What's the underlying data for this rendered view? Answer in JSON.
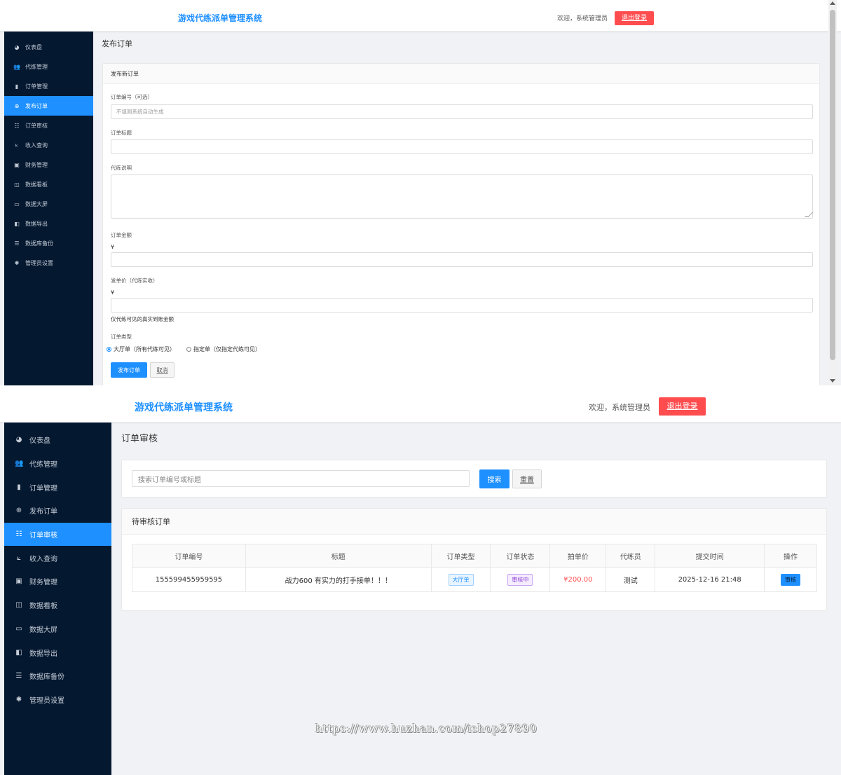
{
  "app": {
    "brand": "游戏代练派单管理系统",
    "welcome": "欢迎，系统管理员",
    "logout": "退出登录"
  },
  "sidebar": {
    "items": [
      {
        "label": "仪表盘",
        "icon": "dashboard-icon",
        "glyph": "◕"
      },
      {
        "label": "代练管理",
        "icon": "users-icon",
        "glyph": "👥"
      },
      {
        "label": "订单管理",
        "icon": "clipboard-icon",
        "glyph": "▮"
      },
      {
        "label": "发布订单",
        "icon": "plus-circle-icon",
        "glyph": "⊕"
      },
      {
        "label": "订单审核",
        "icon": "tasks-icon",
        "glyph": "☷"
      },
      {
        "label": "收入查询",
        "icon": "hand-holding-icon",
        "glyph": "⟀"
      },
      {
        "label": "财务管理",
        "icon": "money-bill-icon",
        "glyph": "▣"
      },
      {
        "label": "数据看板",
        "icon": "chart-icon",
        "glyph": "◫"
      },
      {
        "label": "数据大屏",
        "icon": "desktop-icon",
        "glyph": "▭"
      },
      {
        "label": "数据导出",
        "icon": "file-export-icon",
        "glyph": "◧"
      },
      {
        "label": "数据库备份",
        "icon": "database-icon",
        "glyph": "☰"
      },
      {
        "label": "管理员设置",
        "icon": "gear-icon",
        "glyph": "✱"
      }
    ]
  },
  "publish": {
    "page_title": "发布订单",
    "card_title": "发布新订单",
    "order_no_label": "订单编号（可选）",
    "order_no_placeholder": "不填则系统自动生成",
    "title_label": "订单标题",
    "desc_label": "代练说明",
    "amount_label": "订单金额",
    "amount_prefix": "¥",
    "dispatch_label": "发单价（代练实收）",
    "dispatch_prefix": "¥",
    "dispatch_hint": "仅代练可见的真实到账金额",
    "type_label": "订单类型",
    "type_options": [
      "大厅单（所有代练可见）",
      "指定单（仅指定代练可见）"
    ],
    "type_selected": "大厅单（所有代练可见）",
    "submit": "发布订单",
    "cancel": "取消"
  },
  "review": {
    "page_title": "订单审核",
    "search_placeholder": "搜索订单编号或标题",
    "search_btn": "搜索",
    "reset_btn": "重置",
    "card_title": "待审核订单",
    "columns": [
      "订单编号",
      "标题",
      "订单类型",
      "订单状态",
      "拍单价",
      "代练员",
      "提交时间",
      "操作"
    ],
    "rows": [
      {
        "order_no": "155599455959595",
        "title": "战力600 有实力的打手接单！！！",
        "type": "大厅单",
        "status": "审核中",
        "price": "¥200.00",
        "booster": "测试",
        "submitted": "2025-12-16 21:48",
        "action": "审核"
      }
    ]
  },
  "watermark": "https://www.huzhan.com/ishop27890",
  "colors": {
    "primary": "#1e90ff",
    "sidebar_bg": "#041830",
    "danger": "#ff4d4f",
    "page_bg": "#f0f2f5"
  }
}
